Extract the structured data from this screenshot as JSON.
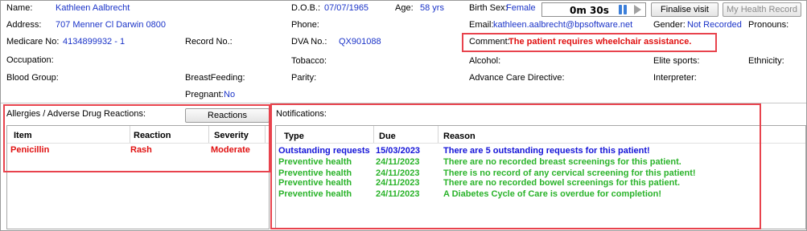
{
  "patient": {
    "name_label": "Name:",
    "name": "Kathleen Aalbrecht",
    "address_label": "Address:",
    "address": "707 Menner Cl  Darwin  0800",
    "medicare_label": "Medicare No:",
    "medicare": "4134899932 - 1",
    "record_label": "Record No.:",
    "occupation_label": "Occupation:",
    "blood_label": "Blood Group:",
    "breastfeeding_label": "BreastFeeding:",
    "pregnant_label": "Pregnant:",
    "pregnant": "No",
    "dob_label": "D.O.B.:",
    "dob": "07/07/1965",
    "age_label": "Age:",
    "age": "58 yrs",
    "phone_label": "Phone:",
    "dva_label": "DVA No.:",
    "dva": "QX901088",
    "tobacco_label": "Tobacco:",
    "parity_label": "Parity:",
    "sex_label": "Birth Sex:",
    "sex": "Female",
    "email_label": "Email:",
    "email": "kathleen.aalbrecht@bpsoftware.net",
    "gender_label": "Gender:",
    "gender": "Not Recorded",
    "pronouns_label": "Pronouns:",
    "comment_label": "Comment:",
    "comment": "The patient requires wheelchair assistance.",
    "alcohol_label": "Alcohol:",
    "elite_label": "Elite sports:",
    "ethnicity_label": "Ethnicity:",
    "acd_label": "Advance Care Directive:",
    "interpreter_label": "Interpreter:"
  },
  "toolbar": {
    "timer": "0m  30s",
    "finalise_label": "Finalise visit",
    "health_record_label": "My Health Record"
  },
  "allergies": {
    "title": "Allergies / Adverse Drug Reactions:",
    "reactions_button": "Reactions",
    "columns": [
      "Item",
      "Reaction",
      "Severity"
    ],
    "rows": [
      {
        "item": "Penicillin",
        "reaction": "Rash",
        "severity": "Moderate"
      }
    ]
  },
  "notifications": {
    "title": "Notifications:",
    "columns": [
      "Type",
      "Due",
      "Reason"
    ],
    "rows": [
      {
        "type": "Outstanding requests",
        "due": "15/03/2023",
        "reason": "There are 5 outstanding requests for this patient!"
      },
      {
        "type": "Preventive health",
        "due": "24/11/2023",
        "reason": "There are no recorded breast screenings for this patient."
      },
      {
        "type": "Preventive health",
        "due": "24/11/2023",
        "reason": "There is no record of any cervical screening for this patient!"
      },
      {
        "type": "Preventive health",
        "due": "24/11/2023",
        "reason": "There are no recorded bowel screenings for this patient."
      },
      {
        "type": "Preventive health",
        "due": "24/11/2023",
        "reason": "A Diabetes Cycle of Care is overdue for completion!"
      }
    ]
  },
  "colors": {
    "value_blue": "#1a33c8",
    "alert_red": "#e01010",
    "notify_blue": "#1414d8",
    "notify_green": "#2ab32a",
    "highlight_border": "#e8434d"
  }
}
